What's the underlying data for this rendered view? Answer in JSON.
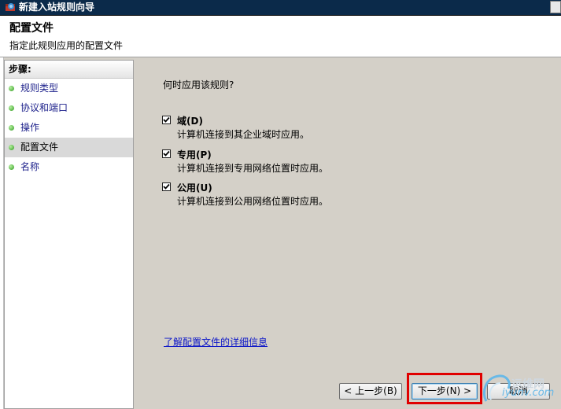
{
  "window": {
    "title": "新建入站规则向导",
    "close_icon": "close-icon"
  },
  "header": {
    "title": "配置文件",
    "subtitle": "指定此规则应用的配置文件"
  },
  "steps": {
    "heading": "步骤:",
    "items": [
      {
        "label": "规则类型",
        "active": false
      },
      {
        "label": "协议和端口",
        "active": false
      },
      {
        "label": "操作",
        "active": false
      },
      {
        "label": "配置文件",
        "active": true
      },
      {
        "label": "名称",
        "active": false
      }
    ]
  },
  "content": {
    "question": "何时应用该规则?",
    "options": [
      {
        "label": "域(D)",
        "description": "计算机连接到其企业域时应用。",
        "checked": true
      },
      {
        "label": "专用(P)",
        "description": "计算机连接到专用网络位置时应用。",
        "checked": true
      },
      {
        "label": "公用(U)",
        "description": "计算机连接到公用网络位置时应用。",
        "checked": true
      }
    ],
    "learn_more": "了解配置文件的详细信息"
  },
  "buttons": {
    "back": "< 上一步(B)",
    "next": "下一步(N) >",
    "cancel": "取消"
  },
  "watermark": {
    "text1": "运维网",
    "text2": "iyunv.com"
  },
  "colors": {
    "titlebar": "#0b2a4a",
    "highlight": "#e00000",
    "link": "#0c16c8",
    "step_text": "#1b1f8a"
  }
}
